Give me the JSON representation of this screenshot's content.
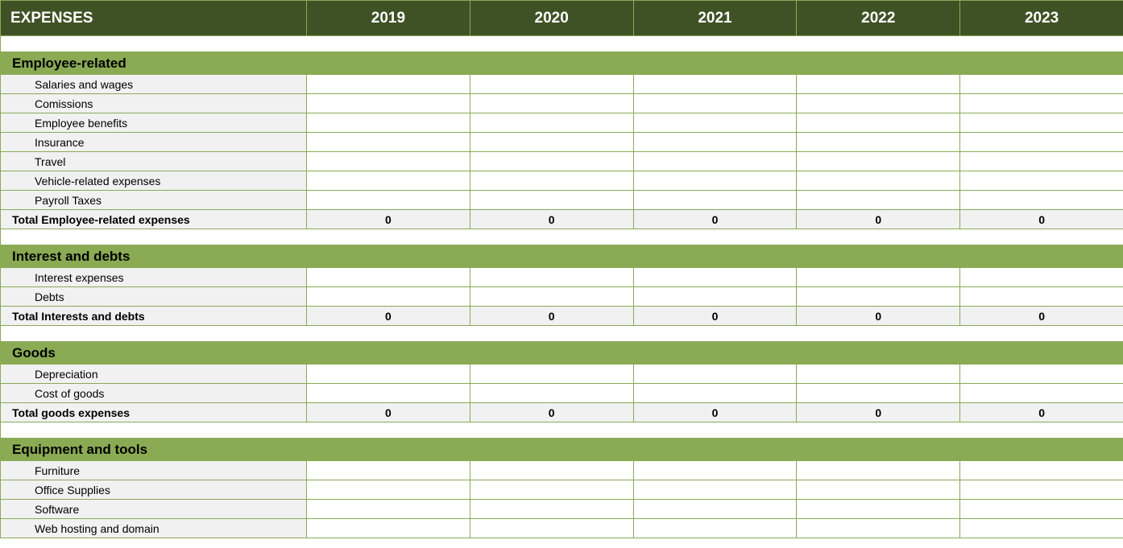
{
  "header": {
    "title": "EXPENSES",
    "years": [
      "2019",
      "2020",
      "2021",
      "2022",
      "2023"
    ]
  },
  "sections": [
    {
      "name": "Employee-related",
      "items": [
        {
          "label": "Salaries and wages",
          "values": [
            "",
            "",
            "",
            "",
            ""
          ]
        },
        {
          "label": "Comissions",
          "values": [
            "",
            "",
            "",
            "",
            ""
          ]
        },
        {
          "label": "Employee benefits",
          "values": [
            "",
            "",
            "",
            "",
            ""
          ]
        },
        {
          "label": "Insurance",
          "values": [
            "",
            "",
            "",
            "",
            ""
          ]
        },
        {
          "label": "Travel",
          "values": [
            "",
            "",
            "",
            "",
            ""
          ]
        },
        {
          "label": "Vehicle-related expenses",
          "values": [
            "",
            "",
            "",
            "",
            ""
          ]
        },
        {
          "label": "Payroll Taxes",
          "values": [
            "",
            "",
            "",
            "",
            ""
          ]
        }
      ],
      "total": {
        "label": "Total Employee-related expenses",
        "values": [
          "0",
          "0",
          "0",
          "0",
          "0"
        ]
      }
    },
    {
      "name": "Interest and debts",
      "items": [
        {
          "label": "Interest expenses",
          "values": [
            "",
            "",
            "",
            "",
            ""
          ]
        },
        {
          "label": "Debts",
          "values": [
            "",
            "",
            "",
            "",
            ""
          ]
        }
      ],
      "total": {
        "label": "Total Interests and debts",
        "values": [
          "0",
          "0",
          "0",
          "0",
          "0"
        ]
      }
    },
    {
      "name": "Goods",
      "items": [
        {
          "label": "Depreciation",
          "values": [
            "",
            "",
            "",
            "",
            ""
          ]
        },
        {
          "label": "Cost of goods",
          "values": [
            "",
            "",
            "",
            "",
            ""
          ]
        }
      ],
      "total": {
        "label": "Total goods expenses",
        "values": [
          "0",
          "0",
          "0",
          "0",
          "0"
        ]
      }
    },
    {
      "name": "Equipment and tools",
      "items": [
        {
          "label": "Furniture",
          "values": [
            "",
            "",
            "",
            "",
            ""
          ]
        },
        {
          "label": "Office Supplies",
          "values": [
            "",
            "",
            "",
            "",
            ""
          ]
        },
        {
          "label": "Software",
          "values": [
            "",
            "",
            "",
            "",
            ""
          ]
        },
        {
          "label": "Web hosting and domain",
          "values": [
            "",
            "",
            "",
            "",
            ""
          ]
        }
      ],
      "total": null
    }
  ]
}
